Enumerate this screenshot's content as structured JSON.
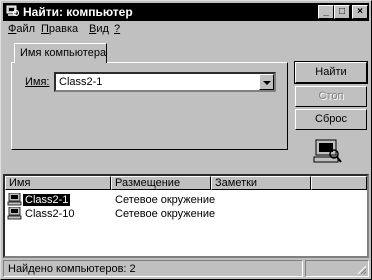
{
  "window": {
    "title": "Найти: компьютер",
    "controls": {
      "minimize": "_",
      "maximize": "□",
      "close": "×"
    }
  },
  "menu": [
    {
      "label": "Файл",
      "accel": "Ф",
      "rest": "айл"
    },
    {
      "label": "Правка",
      "accel": "П",
      "rest": "равка"
    },
    {
      "label": "Вид",
      "accel": "В",
      "rest": "ид"
    },
    {
      "label": "?",
      "accel": "?",
      "rest": ""
    }
  ],
  "tab": {
    "label": "Имя компьютера"
  },
  "form": {
    "name_label": "Имя:",
    "name_value": "Class2-1"
  },
  "buttons": {
    "find": "Найти",
    "stop": "Стоп",
    "reset": "Сброс"
  },
  "list": {
    "columns": [
      "Имя",
      "Размещение",
      "Заметки"
    ],
    "rows": [
      {
        "name": "Class2-1",
        "location": "Сетевое окружение",
        "selected": true
      },
      {
        "name": "Class2-10",
        "location": "Сетевое окружение",
        "selected": false
      }
    ]
  },
  "status": {
    "text": "Найдено компьютеров: 2"
  },
  "icons": {
    "title": "search-computer-icon",
    "big": "computer-search-icon",
    "row": "computer-icon"
  }
}
